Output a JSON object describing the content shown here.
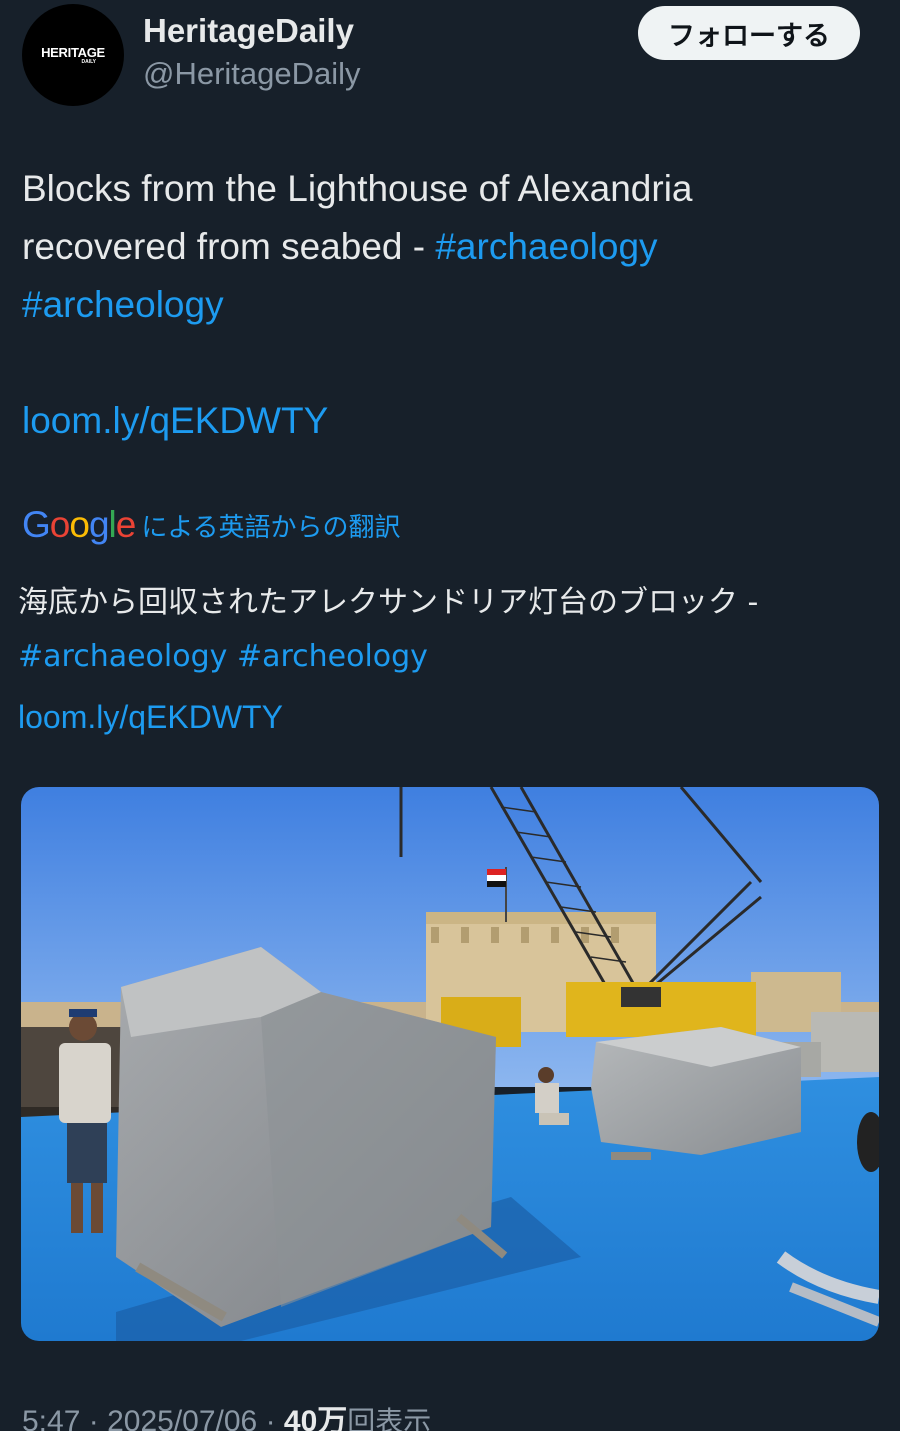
{
  "header": {
    "avatar_text": "HERITAGE",
    "avatar_subtext": "DAILY",
    "display_name": "HeritageDaily",
    "handle": "@HeritageDaily",
    "follow_label": "フォローする"
  },
  "post": {
    "text_part1": "Blocks from the Lighthouse of Alexandria recovered from seabed - ",
    "hashtag1": "#archaeology",
    "hashtag2": "#archeology",
    "link": "loom.ly/qEKDWTY"
  },
  "translation": {
    "google_label": "Google",
    "label": "による英語からの翻訳",
    "text": "海底から回収されたアレクサンドリア灯台のブロック -",
    "hashtag1": "#archaeology",
    "hashtag2": "#archeology",
    "link": "loom.ly/qEKDWTY"
  },
  "footer": {
    "time": "5:47",
    "separator": "·",
    "date": "2025/07/06",
    "views_count": "40万",
    "views_label": "回表示"
  },
  "colors": {
    "background": "#17202a",
    "link": "#1d9bf0",
    "text": "#e7e9ea",
    "muted": "#8b98a5"
  }
}
